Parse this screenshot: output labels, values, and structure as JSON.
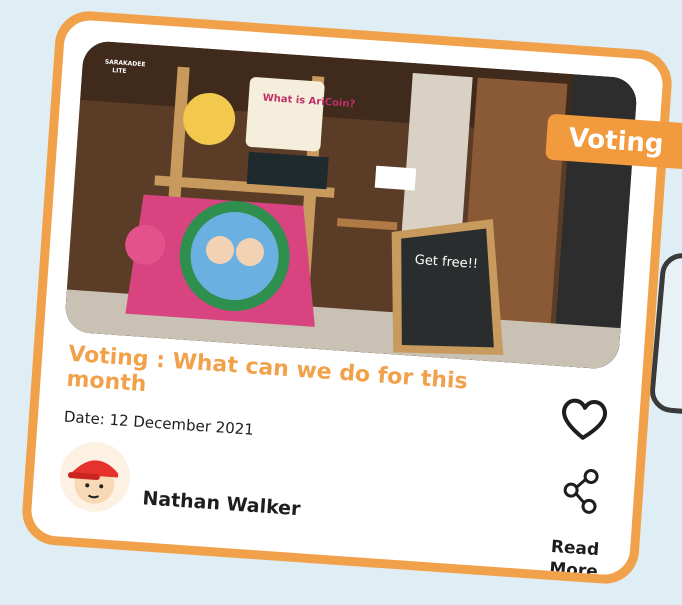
{
  "card": {
    "badge": "Voting",
    "title": "Voting : What can we do for this month",
    "date": "Date: 12 December 2021",
    "author": "Nathan Walker",
    "read_more_line1": "Read",
    "read_more_line2": "More"
  },
  "photo": {
    "watermark_line1": "SARAKADEE",
    "watermark_line2": "LITE",
    "poster_heading": "What is AriCoin?",
    "chalkboard_heading": "Get free!!"
  },
  "icons": {
    "like": "heart-icon",
    "share": "share-icon",
    "avatar": "avatar-red-cap"
  },
  "colors": {
    "accent": "#f29a3e",
    "card_border": "#f2a14b",
    "text": "#1e1e1e",
    "background": "#dfeef5"
  }
}
